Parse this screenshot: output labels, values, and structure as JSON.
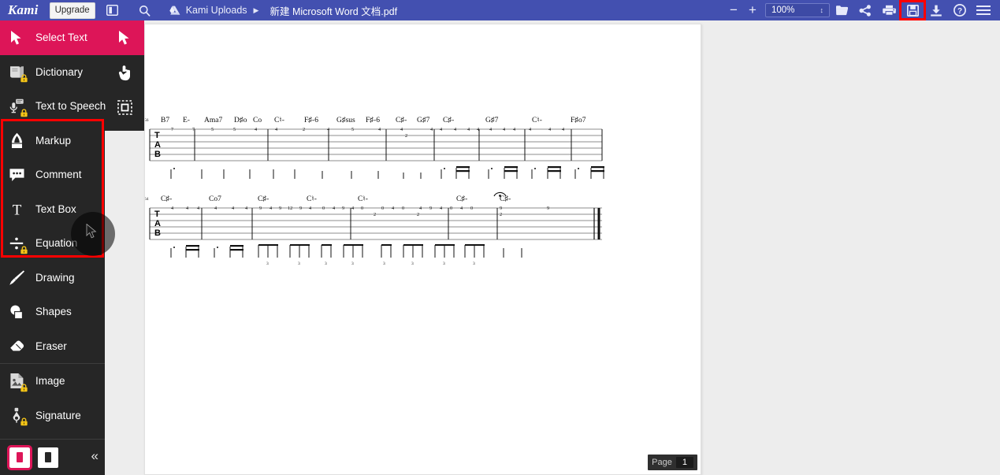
{
  "app": {
    "name": "Kami",
    "upgrade_label": "Upgrade",
    "accent_pink": "#dd1558",
    "header_blue": "#4350b0",
    "highlight_red": "#ff0000"
  },
  "topbar": {
    "panel_icon": "sidebar-panel-icon",
    "search_icon": "search-icon",
    "drive_icon": "google-drive-icon",
    "breadcrumb_root": "Kami Uploads",
    "breadcrumb_separator": "▶",
    "document_title": "新建 Microsoft Word 文档.pdf",
    "zoom_out_label": "−",
    "zoom_in_label": "+",
    "zoom_value": "100%",
    "zoom_spinner": "↕",
    "right_icons": [
      {
        "name": "open-folder-icon",
        "label": "Open"
      },
      {
        "name": "share-icon",
        "label": "Share"
      },
      {
        "name": "print-icon",
        "label": "Print"
      },
      {
        "name": "save-icon",
        "label": "Save",
        "highlighted": true
      },
      {
        "name": "download-icon",
        "label": "Download"
      },
      {
        "name": "help-icon",
        "label": "Help"
      },
      {
        "name": "hamburger-menu-icon",
        "label": "Menu"
      }
    ]
  },
  "sidebar": {
    "items": [
      {
        "label": "Select Text",
        "icon": "cursor-arrow-icon",
        "active": true,
        "locked": false
      },
      {
        "label": "Dictionary",
        "icon": "book-icon",
        "active": false,
        "locked": true
      },
      {
        "label": "Text to Speech",
        "icon": "microphone-icon",
        "active": false,
        "locked": true
      },
      {
        "label": "Markup",
        "icon": "highlighter-icon",
        "active": false,
        "locked": false
      },
      {
        "label": "Comment",
        "icon": "speech-bubble-icon",
        "active": false,
        "locked": false
      },
      {
        "label": "Text Box",
        "icon": "text-t-icon",
        "active": false,
        "locked": false
      },
      {
        "label": "Equation",
        "icon": "division-sign-icon",
        "active": false,
        "locked": true
      },
      {
        "label": "Drawing",
        "icon": "paintbrush-icon",
        "active": false,
        "locked": false
      },
      {
        "label": "Shapes",
        "icon": "shapes-icon",
        "active": false,
        "locked": false
      },
      {
        "label": "Eraser",
        "icon": "eraser-icon",
        "active": false,
        "locked": false
      },
      {
        "label": "Image",
        "icon": "image-icon",
        "active": false,
        "locked": true
      },
      {
        "label": "Signature",
        "icon": "signature-pen-icon",
        "active": false,
        "locked": true
      }
    ],
    "footer": {
      "pageview_single_icon": "single-page-view-icon",
      "pageview_double_icon": "two-page-view-icon",
      "collapse_icon": "double-chevron-left-icon",
      "collapse_label": "«"
    },
    "highlight_box": {
      "covers": [
        "Markup",
        "Comment",
        "Text Box",
        "Equation"
      ]
    }
  },
  "subtools": [
    {
      "name": "pointer-tool",
      "icon": "cursor-arrow-icon",
      "active": true
    },
    {
      "name": "pan-tool",
      "icon": "hand-pointer-icon",
      "active": false
    },
    {
      "name": "area-select-tool",
      "icon": "marquee-select-icon",
      "active": false
    }
  ],
  "statusbar": {
    "page_label": "Page",
    "page_number": "1"
  },
  "document": {
    "type": "guitar-tablature",
    "systems": [
      {
        "measure_number": "56",
        "chords": [
          "B7",
          "E-",
          "Ama7",
          "D♯o",
          "Co",
          "C♮-",
          "F♯-6",
          "G♯sus",
          "F♯-6",
          "C♯-",
          "G♯7",
          "C♯-",
          "G♯7",
          "C♮-",
          "F♯o7"
        ],
        "tab_letters": [
          "T",
          "A",
          "B"
        ],
        "top_string_numbers": [
          "7",
          "7",
          "5",
          "5",
          "4",
          "4",
          "2",
          "4",
          "5",
          "4",
          "4",
          "4",
          "4",
          "4",
          "4",
          "4",
          "4",
          "4",
          "4",
          "4",
          "4",
          "4"
        ],
        "second_string_numbers": [
          "2"
        ]
      },
      {
        "measure_number": "64",
        "chords": [
          "C♯-",
          "Co7",
          "C♯-",
          "C♮-",
          "C♮-",
          "C♯-",
          "C♯-"
        ],
        "tab_letters": [
          "T",
          "A",
          "B"
        ],
        "top_string_numbers": [
          "4",
          "4",
          "4",
          "4",
          "4",
          "4",
          "9",
          "4",
          "9",
          "12",
          "9",
          "4",
          "0",
          "4",
          "9",
          "4",
          "0",
          "0",
          "4",
          "0",
          "4",
          "9",
          "4",
          "0",
          "4",
          "0",
          "9",
          "9"
        ],
        "second_string_numbers": [
          "2",
          "2",
          "2"
        ],
        "has_fermata": true,
        "final_barline": "double-thick"
      }
    ]
  }
}
